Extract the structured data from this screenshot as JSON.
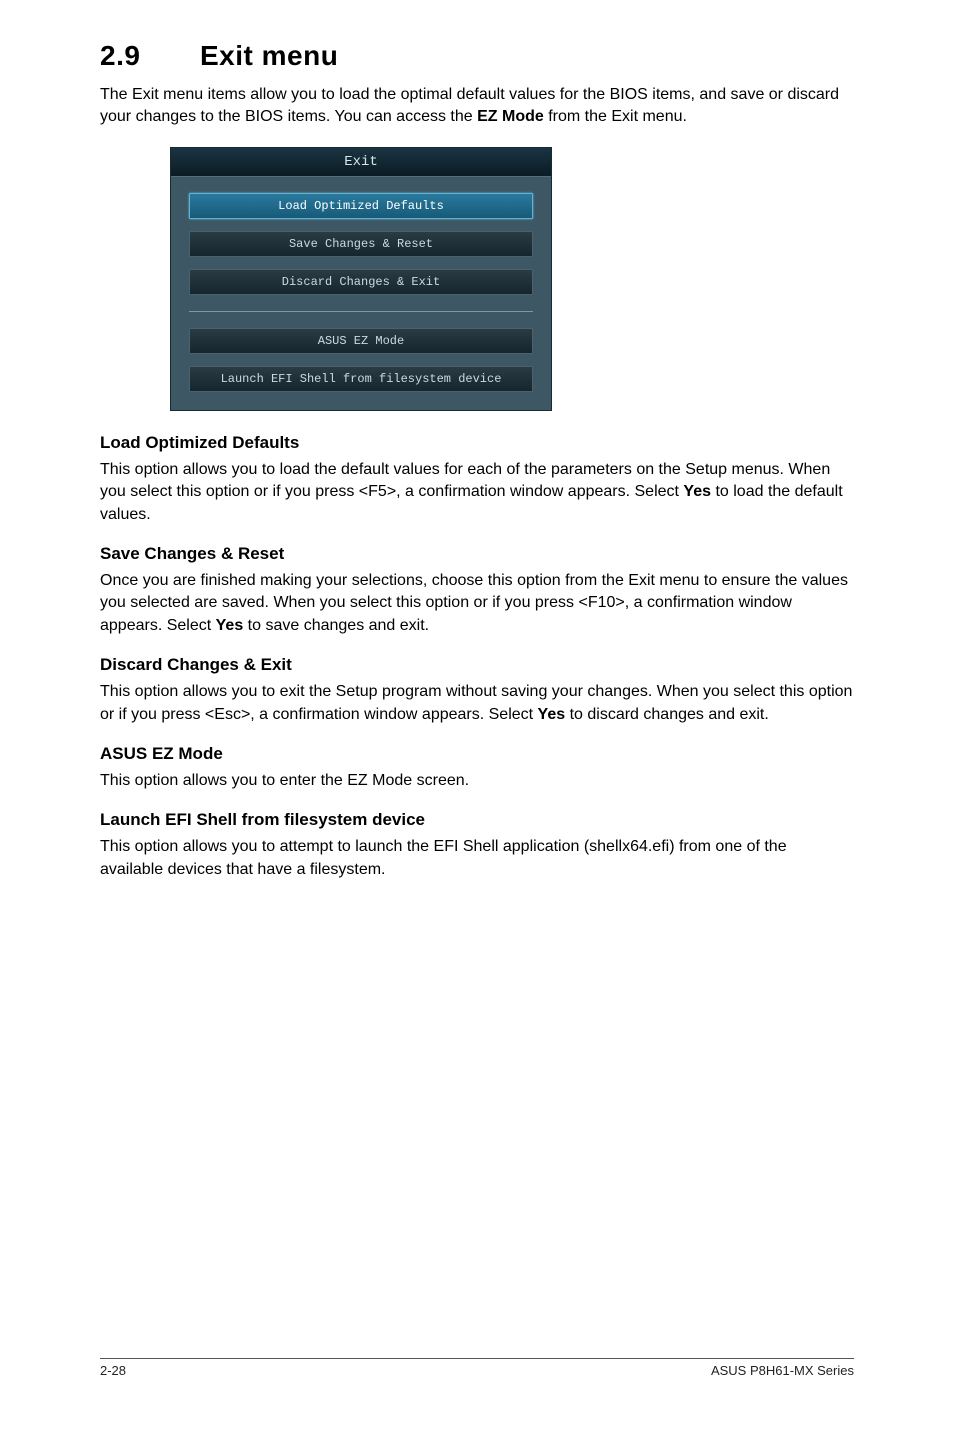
{
  "section": {
    "number": "2.9",
    "title": "Exit menu",
    "intro_parts": [
      "The Exit menu items allow you to load the optimal default values for the BIOS items, and save or discard your changes to the BIOS items. You can access the ",
      "EZ Mode",
      " from the Exit menu."
    ]
  },
  "bios": {
    "title": "Exit",
    "buttons": {
      "load_defaults": "Load Optimized Defaults",
      "save_changes": "Save Changes & Reset",
      "discard_changes": "Discard Changes & Exit",
      "ez_mode": "ASUS EZ Mode",
      "launch_efi": "Launch EFI Shell from filesystem device"
    }
  },
  "subsections": {
    "load_defaults": {
      "heading": "Load Optimized Defaults",
      "body_parts": [
        "This option allows you to load the default values for each of the parameters on the Setup menus. When you select this option or if you press <F5>, a confirmation window appears. Select ",
        "Yes",
        " to load the default values."
      ]
    },
    "save_changes": {
      "heading": "Save Changes & Reset",
      "body_parts": [
        "Once you are finished making your selections, choose this option from the Exit menu to ensure the values you selected are saved. When you select this option or if you press <F10>, a confirmation window appears. Select ",
        "Yes",
        " to save changes and exit."
      ]
    },
    "discard_changes": {
      "heading": "Discard Changes & Exit",
      "body_parts": [
        "This option allows you to exit the Setup program without saving your changes. When you select this option or if you press <Esc>, a confirmation window appears. Select ",
        "Yes",
        " to discard changes and exit."
      ]
    },
    "ez_mode": {
      "heading": "ASUS EZ Mode",
      "body": "This option allows you to enter the EZ Mode screen."
    },
    "launch_efi": {
      "heading": "Launch EFI Shell from filesystem device",
      "body": "This option allows you to attempt to launch the EFI Shell application (shellx64.efi) from one of the available devices that have a filesystem."
    }
  },
  "footer": {
    "left": "2-28",
    "right": "ASUS P8H61-MX Series"
  }
}
